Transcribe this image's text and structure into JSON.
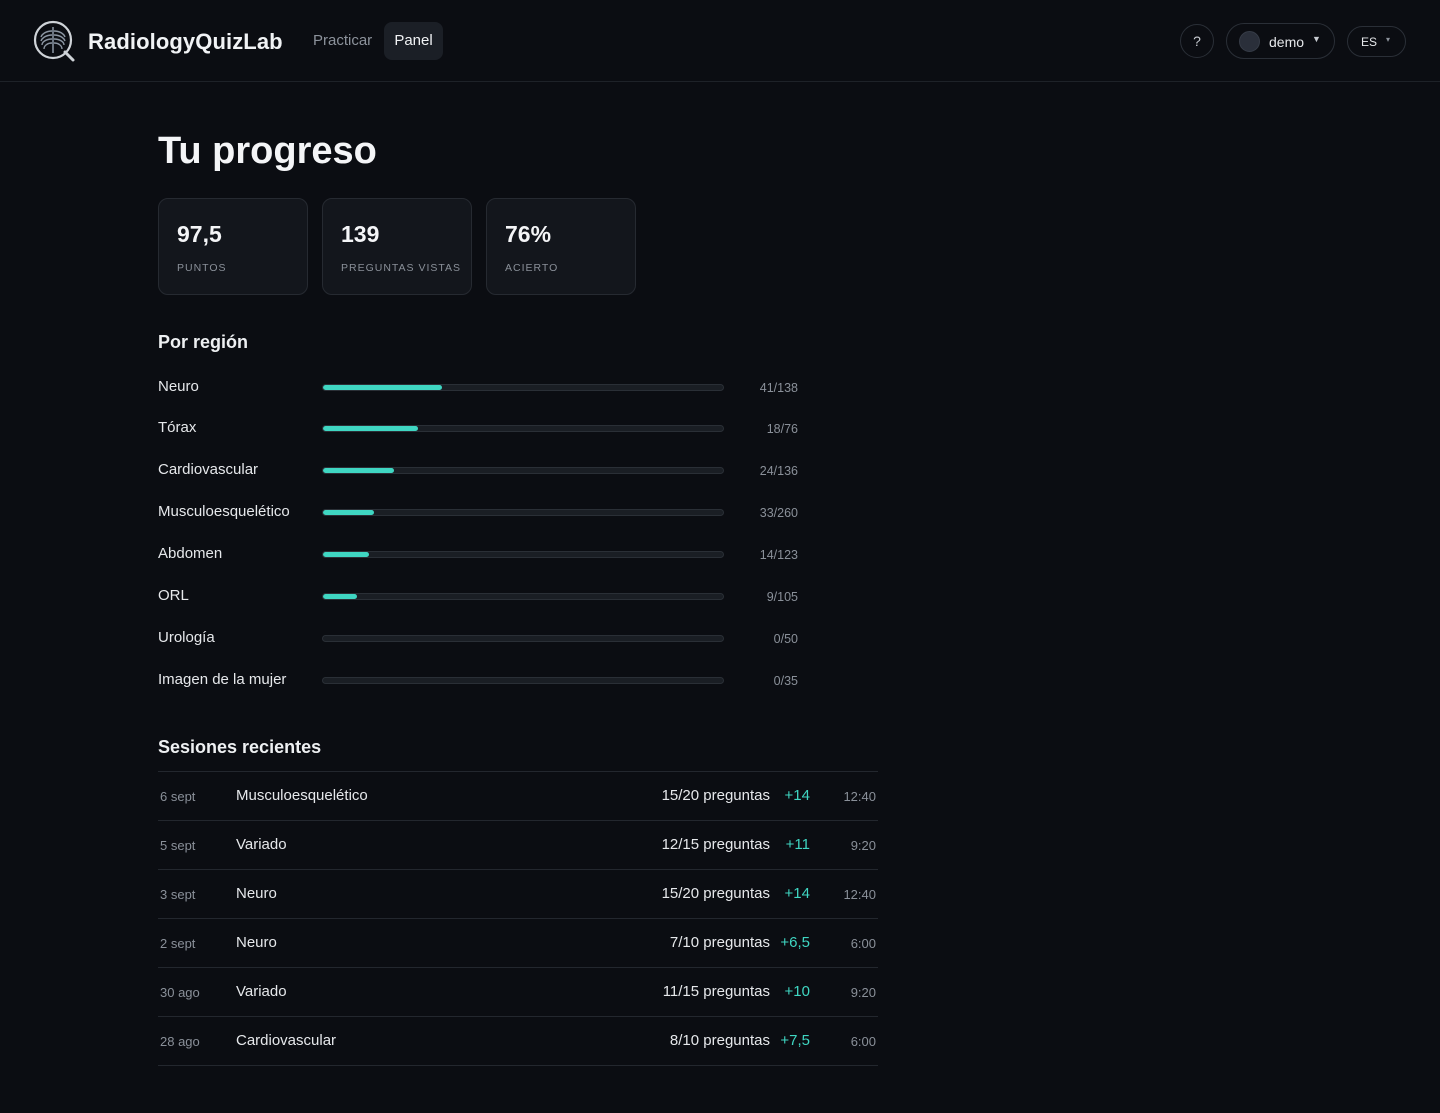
{
  "app": {
    "brand": "RadiologyQuizLab",
    "nav": [
      {
        "label": "Practicar",
        "active": false
      },
      {
        "label": "Panel",
        "active": true
      }
    ],
    "help_label": "?",
    "user_label": "demo",
    "lang_label": "ES",
    "accent_color": "#3fd6c2"
  },
  "page": {
    "title": "Tu progreso"
  },
  "stats": [
    {
      "value": "97,5",
      "label": "PUNTOS"
    },
    {
      "value": "139",
      "label": "PREGUNTAS VISTAS"
    },
    {
      "value": "76%",
      "label": "ACIERTO"
    }
  ],
  "regions": {
    "title": "Por región",
    "items": [
      {
        "name": "Neuro",
        "done": 41,
        "total": 138,
        "count": "41/138"
      },
      {
        "name": "Tórax",
        "done": 18,
        "total": 76,
        "count": "18/76"
      },
      {
        "name": "Cardiovascular",
        "done": 24,
        "total": 136,
        "count": "24/136"
      },
      {
        "name": "Musculoesquelético",
        "done": 33,
        "total": 260,
        "count": "33/260"
      },
      {
        "name": "Abdomen",
        "done": 14,
        "total": 123,
        "count": "14/123"
      },
      {
        "name": "ORL",
        "done": 9,
        "total": 105,
        "count": "9/105"
      },
      {
        "name": "Urología",
        "done": 0,
        "total": 50,
        "count": "0/50"
      },
      {
        "name": "Imagen de la mujer",
        "done": 0,
        "total": 35,
        "count": "0/35"
      }
    ]
  },
  "sessions": {
    "title": "Sesiones recientes",
    "items": [
      {
        "date": "6 sept",
        "region": "Musculoesquelético",
        "questions": "15/20 preguntas",
        "points": "+14",
        "time": "12:40"
      },
      {
        "date": "5 sept",
        "region": "Variado",
        "questions": "12/15 preguntas",
        "points": "+11",
        "time": "9:20"
      },
      {
        "date": "3 sept",
        "region": "Neuro",
        "questions": "15/20 preguntas",
        "points": "+14",
        "time": "12:40"
      },
      {
        "date": "2 sept",
        "region": "Neuro",
        "questions": "7/10 preguntas",
        "points": "+6,5",
        "time": "6:00"
      },
      {
        "date": "30 ago",
        "region": "Variado",
        "questions": "11/15 preguntas",
        "points": "+10",
        "time": "9:20"
      },
      {
        "date": "28 ago",
        "region": "Cardiovascular",
        "questions": "8/10 preguntas",
        "points": "+7,5",
        "time": "6:00"
      }
    ]
  }
}
